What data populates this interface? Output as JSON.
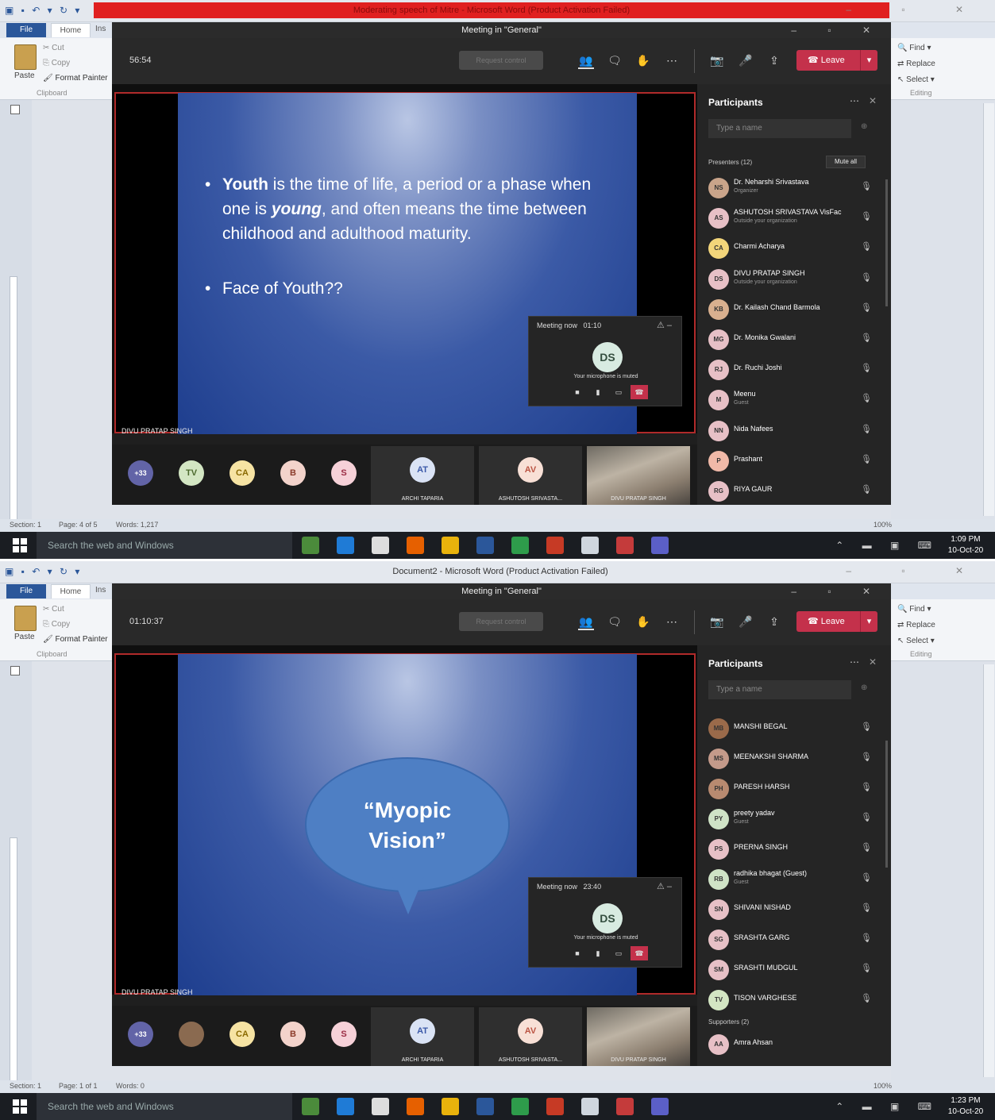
{
  "shots": [
    {
      "word": {
        "title_bar": "Moderating speech of Mitre - Microsoft Word (Product Activation Failed)",
        "tabs": [
          "File",
          "Home",
          "Ins"
        ],
        "clipboard": {
          "paste": "Paste",
          "cut": "Cut",
          "copy": "Copy",
          "format_painter": "Format Painter",
          "group": "Clipboard"
        },
        "editing": {
          "find": "Find",
          "replace": "Replace",
          "select": "Select",
          "group": "Editing"
        },
        "status": {
          "section": "Section: 1",
          "page": "Page: 4 of 5",
          "words": "Words: 1,217",
          "zoom": "100%"
        }
      },
      "taskbar": {
        "search": "Search the web and Windows",
        "time": "1:09 PM",
        "date": "10-Oct-20"
      },
      "teams": {
        "title": "Meeting in \"General\"",
        "timer": "56:54",
        "request_control": "Request control",
        "leave": "Leave",
        "speaker_name": "DIVU PRATAP SINGH",
        "mini": {
          "title": "Meeting now",
          "time": "01:10",
          "initials": "DS",
          "note": "Your microphone is muted"
        },
        "gallery": {
          "more": "+33",
          "avatars": [
            {
              "initials": "TV",
              "color": "#d3e6c3",
              "text": "#4c6a2e"
            },
            {
              "initials": "CA",
              "color": "#f6e3a3",
              "text": "#8a6a00"
            },
            {
              "initials": "B",
              "color": "#f3d3cb",
              "text": "#8b3b2a"
            },
            {
              "initials": "S",
              "color": "#f6d1d8",
              "text": "#9b2d44"
            }
          ],
          "tiles": [
            {
              "initials": "AT",
              "name": "ARCHI TAPARIA"
            },
            {
              "initials": "AV",
              "name": "ASHUTOSH SRIVASTA..."
            },
            {
              "name": "DIVU PRATAP SINGH"
            }
          ]
        },
        "panel": {
          "title": "Participants",
          "search_placeholder": "Type a name",
          "section": "Presenters (12)",
          "mute_all": "Mute all",
          "people": [
            {
              "initials": "NS",
              "name": "Dr. Neharshi Srivastava",
              "sub": "Organizer",
              "color": "#c9a48a"
            },
            {
              "initials": "AS",
              "name": "ASHUTOSH SRIVASTAVA VisFac",
              "sub": "Outside your organization",
              "color": "#e7c0c6"
            },
            {
              "initials": "CA",
              "name": "Charmi Acharya",
              "sub": "",
              "color": "#f2d57a"
            },
            {
              "initials": "DS",
              "name": "DIVU PRATAP SINGH",
              "sub": "Outside your organization",
              "color": "#e7c0c6"
            },
            {
              "initials": "KB",
              "name": "Dr. Kailash Chand Barmola",
              "sub": "",
              "color": "#d9b08f"
            },
            {
              "initials": "MG",
              "name": "Dr. Monika Gwalani",
              "sub": "",
              "color": "#e7c0c6"
            },
            {
              "initials": "RJ",
              "name": "Dr. Ruchi Joshi",
              "sub": "",
              "color": "#e7c0c6"
            },
            {
              "initials": "M",
              "name": "Meenu",
              "sub": "Guest",
              "color": "#e7c0c6"
            },
            {
              "initials": "NN",
              "name": "Nida Nafees",
              "sub": "",
              "color": "#e7c0c6"
            },
            {
              "initials": "P",
              "name": "Prashant",
              "sub": "",
              "color": "#f0b9a8"
            },
            {
              "initials": "RG",
              "name": "RIYA GAUR",
              "sub": "",
              "color": "#e7c0c6"
            }
          ]
        },
        "slide": {
          "type": "bullets",
          "b1_bold": "Youth",
          "b1_a": " is the time of life, a period or a phase when one is ",
          "b1_italic": "young",
          "b1_b": ", and often means the time between childhood and adulthood maturity.",
          "b2": "Face of Youth??"
        }
      }
    },
    {
      "word": {
        "title_bar": "Document2 - Microsoft Word (Product Activation Failed)",
        "tabs": [
          "File",
          "Home",
          "Ins"
        ],
        "clipboard": {
          "paste": "Paste",
          "cut": "Cut",
          "copy": "Copy",
          "format_painter": "Format Painter",
          "group": "Clipboard"
        },
        "editing": {
          "find": "Find",
          "replace": "Replace",
          "select": "Select",
          "group": "Editing"
        },
        "status": {
          "section": "Section: 1",
          "page": "Page: 1 of 1",
          "words": "Words: 0",
          "zoom": "100%"
        }
      },
      "taskbar": {
        "search": "Search the web and Windows",
        "time": "1:23 PM",
        "date": "10-Oct-20"
      },
      "teams": {
        "title": "Meeting in \"General\"",
        "timer": "01:10:37",
        "request_control": "Request control",
        "leave": "Leave",
        "speaker_name": "DIVU PRATAP SINGH",
        "mini": {
          "title": "Meeting now",
          "time": "23:40",
          "initials": "DS",
          "note": "Your microphone is muted"
        },
        "gallery": {
          "more": "+33",
          "avatars": [
            {
              "initials": "",
              "color": "#8a6a50",
              "text": "#fff"
            },
            {
              "initials": "CA",
              "color": "#f6e3a3",
              "text": "#8a6a00"
            },
            {
              "initials": "B",
              "color": "#f3d3cb",
              "text": "#8b3b2a"
            },
            {
              "initials": "S",
              "color": "#f6d1d8",
              "text": "#9b2d44"
            }
          ],
          "tiles": [
            {
              "initials": "AT",
              "name": "ARCHI TAPARIA"
            },
            {
              "initials": "AV",
              "name": "ASHUTOSH SRIVASTA..."
            },
            {
              "name": "DIVU PRATAP SINGH"
            }
          ]
        },
        "panel": {
          "title": "Participants",
          "search_placeholder": "Type a name",
          "section": "",
          "mute_all": "",
          "people": [
            {
              "initials": "MB",
              "name": "MANSHI BEGAL",
              "sub": "",
              "color": "#9a6a4a"
            },
            {
              "initials": "MS",
              "name": "MEENAKSHI SHARMA",
              "sub": "",
              "color": "#c49a8a"
            },
            {
              "initials": "PH",
              "name": "PARESH HARSH",
              "sub": "",
              "color": "#b88a70"
            },
            {
              "initials": "PY",
              "name": "preety yadav",
              "sub": "Guest",
              "color": "#cfe3c6"
            },
            {
              "initials": "PS",
              "name": "PRERNA SINGH",
              "sub": "",
              "color": "#e7c0c6"
            },
            {
              "initials": "RB",
              "name": "radhika bhagat (Guest)",
              "sub": "Guest",
              "color": "#cfe3c6"
            },
            {
              "initials": "SN",
              "name": "SHIVANI NISHAD",
              "sub": "",
              "color": "#e7c0c6"
            },
            {
              "initials": "SG",
              "name": "SRASHTA GARG",
              "sub": "",
              "color": "#e7c0c6"
            },
            {
              "initials": "SM",
              "name": "SRASHTI MUDGUL",
              "sub": "",
              "color": "#e7c0c6"
            },
            {
              "initials": "TV",
              "name": "TISON VARGHESE",
              "sub": "",
              "color": "#d3e6c3"
            }
          ],
          "section2": "Supporters (2)",
          "extra": {
            "initials": "AA",
            "name": "Amra Ahsan",
            "color": "#e7c0c6"
          }
        },
        "slide": {
          "type": "bubble",
          "text1": "“Myopic",
          "text2": "Vision”"
        }
      }
    }
  ]
}
